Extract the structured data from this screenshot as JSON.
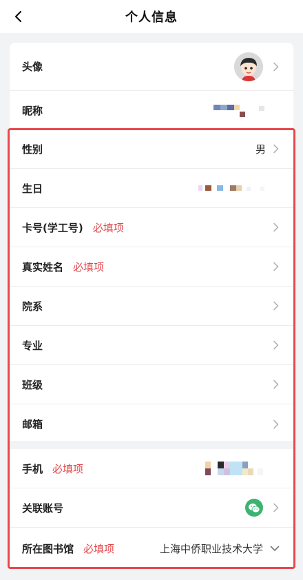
{
  "nav": {
    "title": "个人信息"
  },
  "profile": {
    "avatar_label": "头像",
    "nickname_label": "昵称"
  },
  "details": {
    "gender_label": "性别",
    "gender_value": "男",
    "birthday_label": "生日",
    "card_label": "卡号(学工号)",
    "card_required": "必填项",
    "realname_label": "真实姓名",
    "realname_required": "必填项",
    "department_label": "院系",
    "major_label": "专业",
    "class_label": "班级",
    "email_label": "邮箱"
  },
  "account": {
    "phone_label": "手机",
    "phone_required": "必填项",
    "linked_label": "关联账号",
    "linked_icon": "wechat-icon",
    "library_label": "所在图书馆",
    "library_required": "必填项",
    "library_value": "上海中侨职业技术大学"
  },
  "colors": {
    "required": "#e0474b",
    "frame": "#e8484d",
    "wechat": "#3cb371"
  }
}
